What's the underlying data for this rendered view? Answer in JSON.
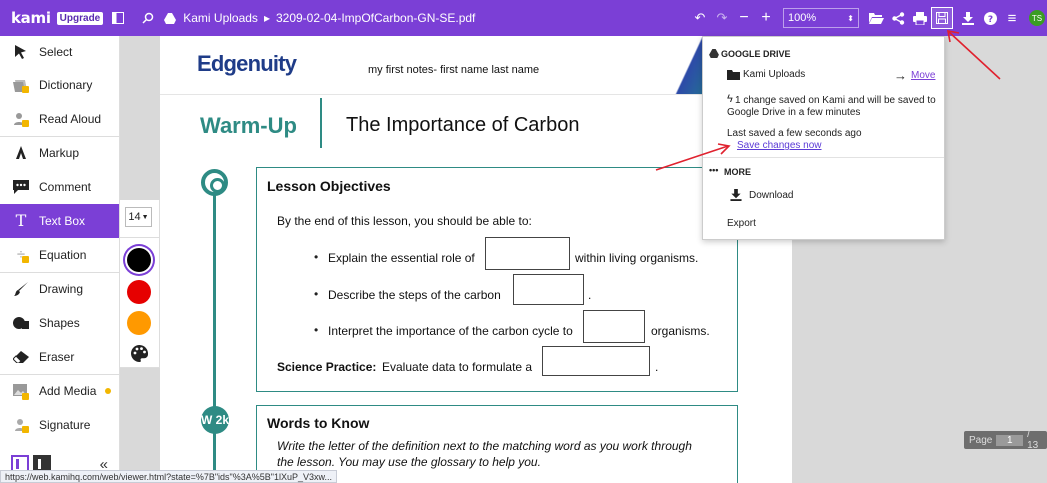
{
  "topbar": {
    "logo": "kami",
    "upgrade": "Upgrade",
    "breadcrumb_folder": "Kami Uploads",
    "breadcrumb_sep": "▸",
    "file_name": "3209-02-04-ImpOfCarbon-GN-SE.pdf",
    "zoom": "100%",
    "avatar_initials": "TS"
  },
  "sidebar": {
    "tools": [
      {
        "label": "Select",
        "icon": "cursor-icon"
      },
      {
        "label": "Dictionary",
        "icon": "dictionary-icon"
      },
      {
        "label": "Read Aloud",
        "icon": "read-aloud-icon"
      },
      {
        "label": "Markup",
        "icon": "markup-icon"
      },
      {
        "label": "Comment",
        "icon": "comment-icon"
      },
      {
        "label": "Text Box",
        "icon": "text-box-icon"
      },
      {
        "label": "Equation",
        "icon": "equation-icon"
      },
      {
        "label": "Drawing",
        "icon": "drawing-icon"
      },
      {
        "label": "Shapes",
        "icon": "shapes-icon"
      },
      {
        "label": "Eraser",
        "icon": "eraser-icon"
      },
      {
        "label": "Add Media",
        "icon": "add-media-icon"
      },
      {
        "label": "Signature",
        "icon": "signature-icon"
      }
    ],
    "collapse": "«"
  },
  "subbar": {
    "font_size": "14",
    "colors": [
      "#000000",
      "#e60000",
      "#ff9900"
    ]
  },
  "document": {
    "brand": "Edgenuity",
    "brand_sub": "my first notes- first name last name",
    "warmup": "Warm-Up",
    "title": "The Importance of Carbon",
    "objectives_heading": "Lesson Objectives",
    "intro": "By the end of this lesson, you should be able to:",
    "obj1_before": "Explain the essential role of",
    "obj1_after": "within living organisms.",
    "obj2_before": "Describe the steps of the carbon",
    "obj2_after": ".",
    "obj3_before": "Interpret the importance of the carbon cycle to",
    "obj3_after": "organisms.",
    "sci_label": "Science Practice:",
    "sci_text": "Evaluate data to formulate a",
    "sci_after": ".",
    "words_heading": "Words to Know",
    "words_line1": "Write the letter of the definition next to the matching word as you work through",
    "words_line2": "the lesson. You may use the glossary to help you.",
    "timeline_badge": "W 2k"
  },
  "dropdown": {
    "drive_heading": "GOOGLE DRIVE",
    "folder": "Kami Uploads",
    "move": "Move",
    "change_line1": "1 change saved on Kami and will be saved to",
    "change_line2": "Google Drive in a few minutes",
    "last_saved": "Last saved a few seconds ago",
    "save_now": "Save changes now",
    "more_heading": "MORE",
    "download": "Download",
    "export": "Export"
  },
  "page_nav": {
    "label": "Page",
    "current": "1",
    "total": "/ 13"
  },
  "status_url": "https://web.kamihq.com/web/viewer.html?state=%7B\"ids\"%3A%5B\"1lXuP_V3xw..."
}
